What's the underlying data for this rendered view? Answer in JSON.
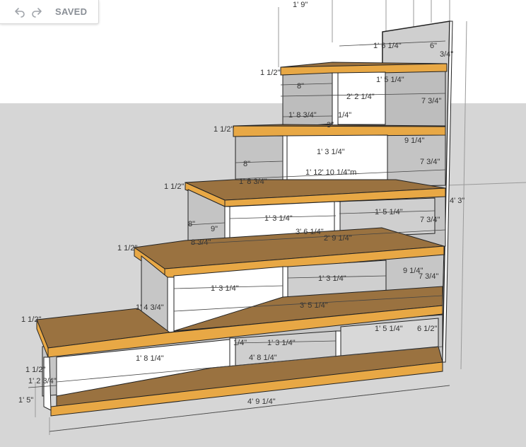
{
  "toolbar": {
    "undo_icon": "undo-icon",
    "redo_icon": "redo-icon",
    "status_label": "SAVED"
  },
  "colors": {
    "sky": "#ffffff",
    "ground": "#d6d6d6",
    "shelf_face": "#e8a845",
    "shelf_top": "#9a7240",
    "panel_white": "#ffffff",
    "panel_gray": "#cfcfcf",
    "edge": "#222222"
  },
  "dimensions": [
    {
      "id": "top-width",
      "text": "1' 9\""
    },
    {
      "id": "top-shelf-depth",
      "text": "1' 6 1/4\""
    },
    {
      "id": "top-right-offset",
      "text": "6\""
    },
    {
      "id": "top-right-small",
      "text": "3/4\""
    },
    {
      "id": "tier1-thickness",
      "text": "1 1/2\""
    },
    {
      "id": "tier1-riser",
      "text": "8\""
    },
    {
      "id": "tier1-inner",
      "text": "1' 5 1/4\""
    },
    {
      "id": "tier1-length",
      "text": "2' 2 1/4\""
    },
    {
      "id": "tier1-side",
      "text": "7 3/4\""
    },
    {
      "id": "tier1-bottom",
      "text": "1' 8 3/4\""
    },
    {
      "id": "tier1-small",
      "text": "1/4\""
    },
    {
      "id": "tier1-small-2",
      "text": "3\""
    },
    {
      "id": "tier2-thickness",
      "text": "1 1/2\""
    },
    {
      "id": "tier2-right",
      "text": "9 1/4\""
    },
    {
      "id": "tier2-inner",
      "text": "1' 3 1/4\""
    },
    {
      "id": "tier2-riser",
      "text": "8\""
    },
    {
      "id": "tier2-side",
      "text": "7 3/4\""
    },
    {
      "id": "tier2-length",
      "text": "1' 12' 10 1/4\"m"
    },
    {
      "id": "tier2-bottom",
      "text": "1' 8 3/4\""
    },
    {
      "id": "tier3-thickness",
      "text": "1 1/2\""
    },
    {
      "id": "tier3-riser",
      "text": "8\""
    },
    {
      "id": "tier3-inner-a",
      "text": "1' 3 1/4\""
    },
    {
      "id": "tier3-inner-b",
      "text": "1' 5 1/4\""
    },
    {
      "id": "tier3-side",
      "text": "7 3/4\""
    },
    {
      "id": "tier3-small",
      "text": "9\""
    },
    {
      "id": "tier3-length",
      "text": "3' 6 1/4\""
    },
    {
      "id": "tier3-depth",
      "text": "2' 9 1/4\""
    },
    {
      "id": "tier3-bottom",
      "text": "8 3/4\""
    },
    {
      "id": "overall-height",
      "text": "4' 3\""
    },
    {
      "id": "tier4-thickness",
      "text": "1 1/2\""
    },
    {
      "id": "tier4-right",
      "text": "9 1/4\""
    },
    {
      "id": "tier4-inner",
      "text": "1' 3 1/4\""
    },
    {
      "id": "tier4-side",
      "text": "7 3/4\""
    },
    {
      "id": "tier4-bottom",
      "text": "1' 4 3/4\""
    },
    {
      "id": "tier4-length",
      "text": "3' 5 1/4\""
    },
    {
      "id": "base-thickness",
      "text": "1 1/2\""
    },
    {
      "id": "base-inner-a",
      "text": "1' 5 1/4\""
    },
    {
      "id": "base-right",
      "text": "6 1/2\""
    },
    {
      "id": "base-inner-b",
      "text": "1' 3 1/4\""
    },
    {
      "id": "base-small",
      "text": "1/4\""
    },
    {
      "id": "base-depth",
      "text": "1' 8 1/4\""
    },
    {
      "id": "base-length",
      "text": "4' 8 1/4\""
    },
    {
      "id": "base-side-a",
      "text": "1 1/2\""
    },
    {
      "id": "base-side-b",
      "text": "1' 2 3/4\""
    },
    {
      "id": "base-height",
      "text": "1' 5\""
    },
    {
      "id": "overall-length",
      "text": "4' 9 1/4\""
    }
  ]
}
